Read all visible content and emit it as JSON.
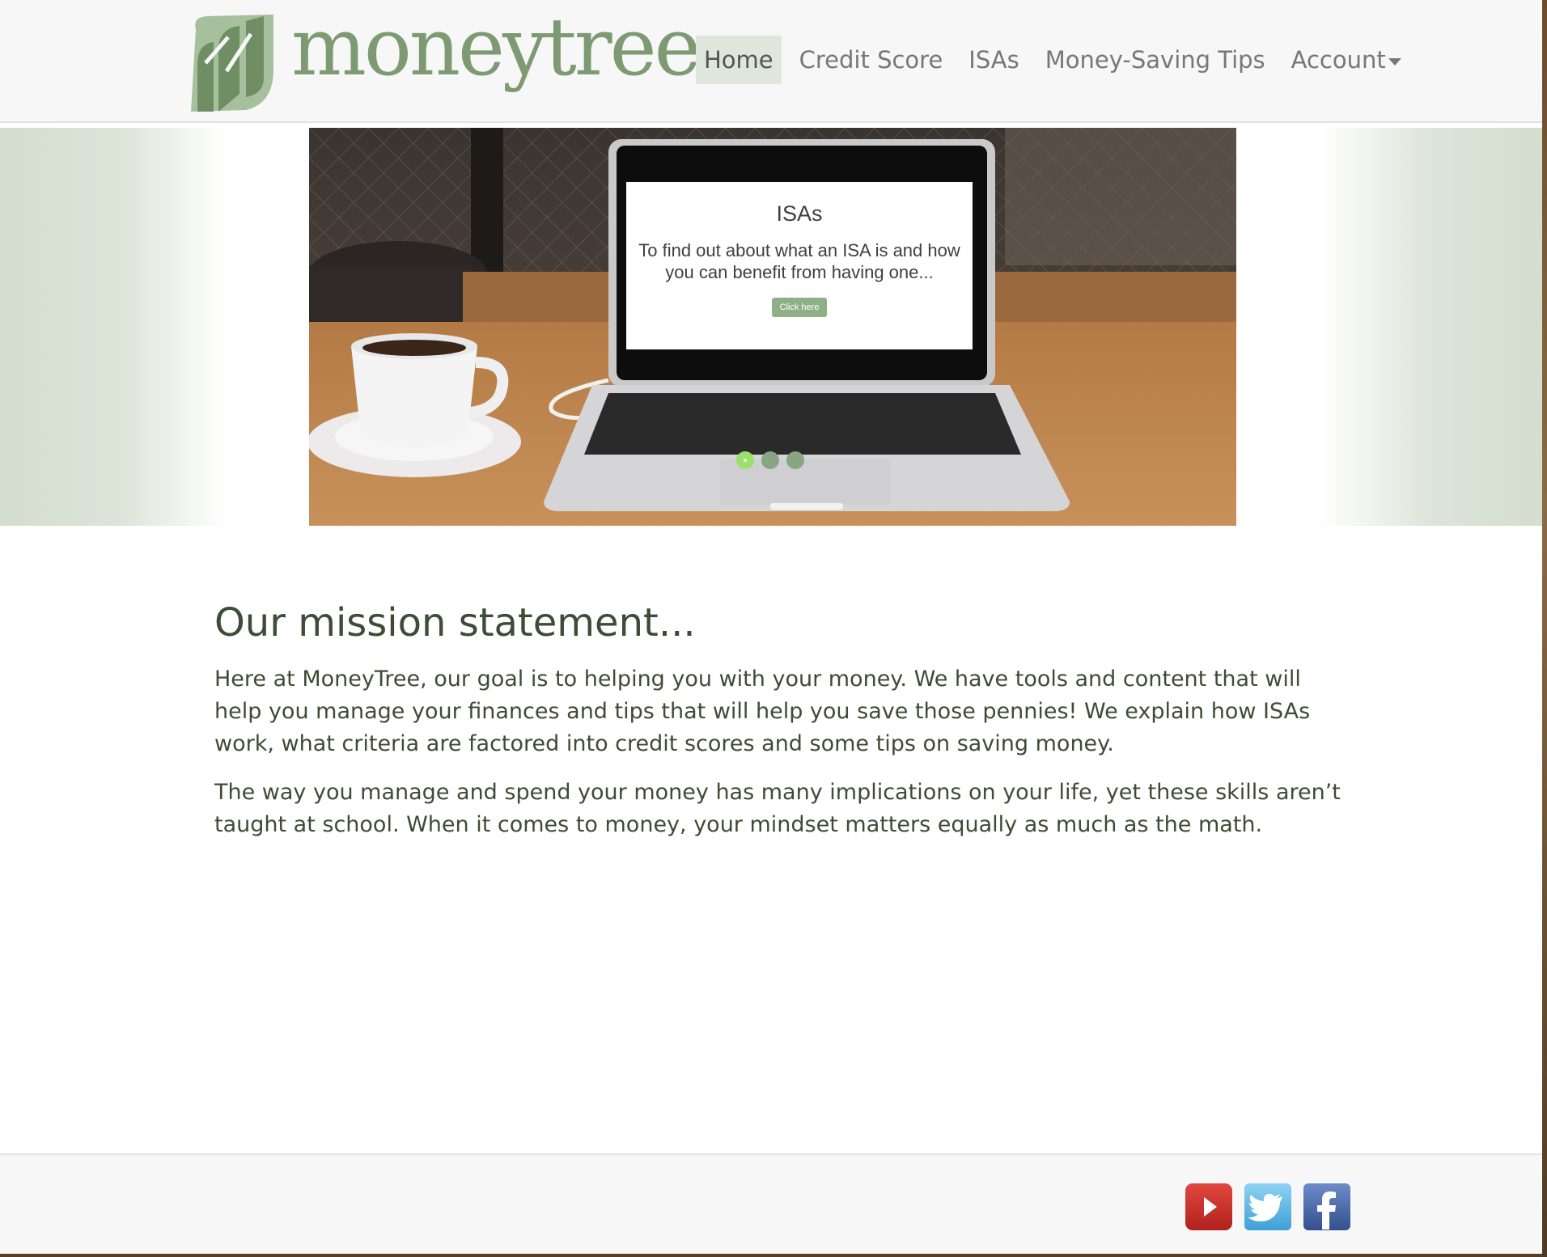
{
  "brand": {
    "name": "moneytree"
  },
  "nav": {
    "items": [
      {
        "label": "Home",
        "active": true
      },
      {
        "label": "Credit Score",
        "active": false
      },
      {
        "label": "ISAs",
        "active": false
      },
      {
        "label": "Money-Saving Tips",
        "active": false
      },
      {
        "label": "Account",
        "active": false,
        "dropdown": true
      }
    ]
  },
  "carousel": {
    "slide": {
      "title": "ISAs",
      "text": "To find out about what an ISA is and how you can benefit from having one...",
      "button_label": "Click here"
    },
    "slide_count": 3,
    "active_index": 0
  },
  "mission": {
    "heading": "Our mission statement...",
    "paragraphs": [
      "Here at MoneyTree, our goal is to helping you with your money. We have tools and content that will help you manage your finances and tips that will help you save those pennies! We explain how ISAs work, what criteria are factored into credit scores and some tips on saving money.",
      "The way you manage and spend your money has many implications on your life, yet these skills aren’t taught at school. When it comes to money, your mindset matters equally as much as the math."
    ]
  },
  "footer": {
    "social": [
      {
        "name": "youtube-icon",
        "color": "#c4302b"
      },
      {
        "name": "twitter-icon",
        "color": "#55acee"
      },
      {
        "name": "facebook-icon",
        "color": "#3b5998"
      }
    ]
  },
  "colors": {
    "brand_green": "#7d9a72",
    "nav_active_bg": "#dfe6dc",
    "text": "#3d4c35",
    "dot_active": "#9be06b"
  }
}
